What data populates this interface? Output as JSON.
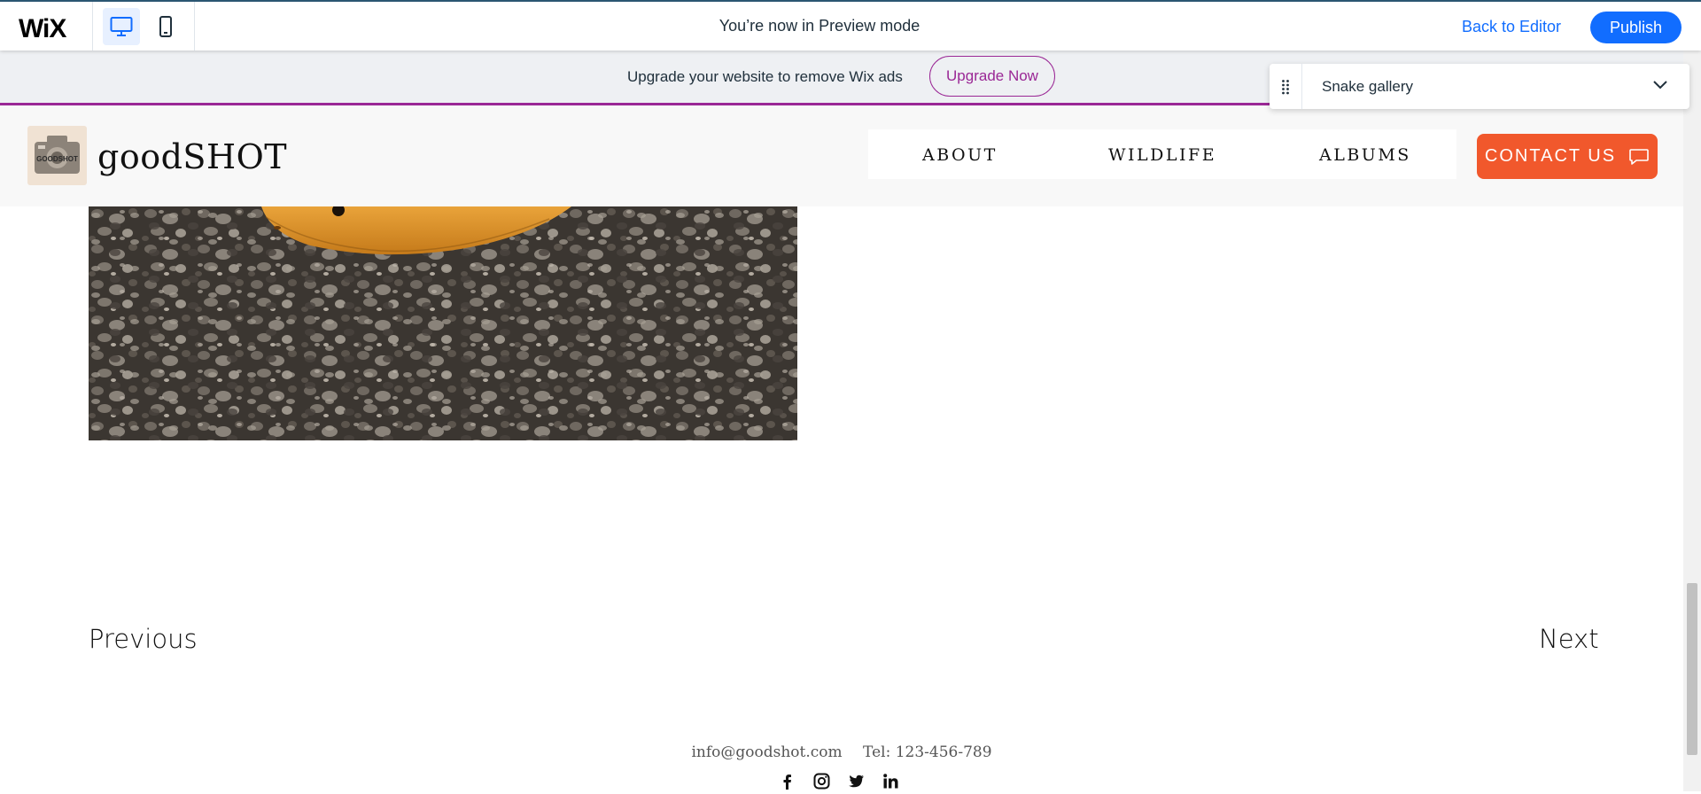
{
  "wix_bar": {
    "logo": "WiX",
    "preview_message": "You’re now in Preview mode",
    "back_to_editor": "Back to Editor",
    "publish": "Publish",
    "device_modes": [
      {
        "name": "desktop",
        "icon": "desktop-icon",
        "active": true
      },
      {
        "name": "mobile",
        "icon": "mobile-icon",
        "active": false
      }
    ]
  },
  "upgrade_banner": {
    "text": "Upgrade your website to remove Wix ads",
    "button": "Upgrade Now",
    "accent_color": "#9a2795"
  },
  "page_selector": {
    "value": "Snake gallery",
    "icons": [
      "drag-handle-icon",
      "chevron-down-icon"
    ]
  },
  "site_header": {
    "logo_text": "GOODSHOT",
    "title": "goodSHOT",
    "nav": [
      "ABOUT",
      "WILDLIFE",
      "ALBUMS"
    ],
    "contact_button": "CONTACT US",
    "contact_color": "#f1582c"
  },
  "pager": {
    "previous": "Previous",
    "next": "Next"
  },
  "footer": {
    "email": "info@goodshot.com",
    "phone": "Tel: 123-456-789",
    "social": [
      "facebook-icon",
      "instagram-icon",
      "twitter-icon",
      "linkedin-icon"
    ]
  },
  "colors": {
    "wix_blue": "#116dff",
    "banner_bg": "#eef0f3",
    "header_bg": "#f8f8f8"
  }
}
